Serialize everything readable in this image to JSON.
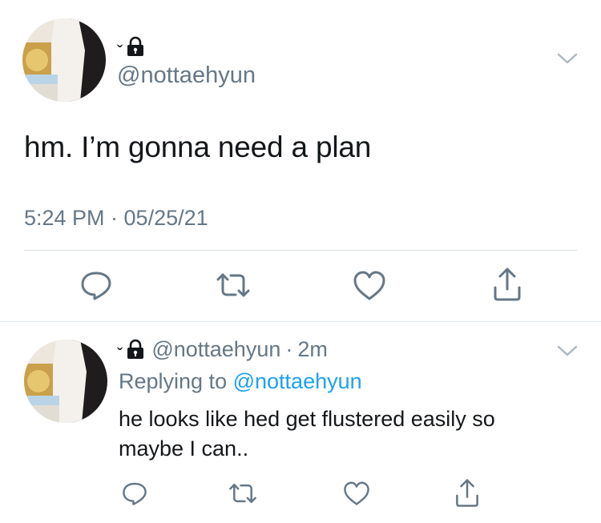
{
  "main_tweet": {
    "display_name": "ˇ",
    "handle": "@nottaehyun",
    "text": "hm. I’m gonna need a plan",
    "timestamp": "5:24 PM · 05/25/21"
  },
  "reply_tweet": {
    "display_name": "ˇ",
    "handle": "@nottaehyun",
    "separator": "·",
    "age": "2m",
    "replying_prefix": "Replying to",
    "replying_handle": "@nottaehyun",
    "text_line1": "he looks like hed get flustered easily so",
    "text_line2": "maybe I can.."
  },
  "icons": {
    "reply": "reply-icon",
    "retweet": "retweet-icon",
    "like": "heart-icon",
    "share": "share-icon",
    "lock": "lock-icon",
    "more": "chevron-down-icon"
  },
  "colors": {
    "text": "#14171a",
    "secondary": "#657786",
    "link": "#1da1f2",
    "divider": "#d9dee3"
  }
}
